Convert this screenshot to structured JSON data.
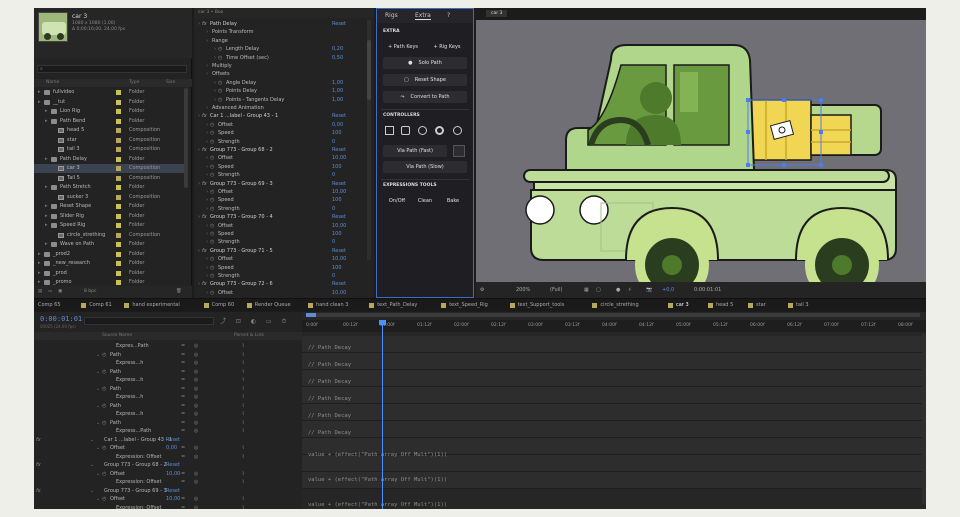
{
  "project": {
    "name": "car 3",
    "meta": [
      "1080 x 1080 (1.00)",
      "Δ 0;00;16;00, 24,00 fps"
    ],
    "columns": [
      "Name",
      "Type",
      "Size"
    ],
    "items": [
      {
        "label": "fullvideo",
        "type": "Folder",
        "color": "#c9c24f",
        "indent": 0,
        "kind": "folder"
      },
      {
        "label": "__tut",
        "type": "Folder",
        "color": "#c9c24f",
        "indent": 0,
        "kind": "folder"
      },
      {
        "label": "Lion Rig",
        "type": "Folder",
        "color": "#c9c24f",
        "indent": 1,
        "kind": "folder"
      },
      {
        "label": "Path Bend",
        "type": "Folder",
        "color": "#c9c24f",
        "indent": 1,
        "kind": "folder"
      },
      {
        "label": "head 5",
        "type": "Composition",
        "color": "#b7a85a",
        "indent": 2,
        "kind": "comp"
      },
      {
        "label": "star",
        "type": "Composition",
        "color": "#b7a85a",
        "indent": 2,
        "kind": "comp"
      },
      {
        "label": "tail 3",
        "type": "Composition",
        "color": "#b7a85a",
        "indent": 2,
        "kind": "comp"
      },
      {
        "label": "Path Delay",
        "type": "Folder",
        "color": "#c9c24f",
        "indent": 1,
        "kind": "folder"
      },
      {
        "label": "car 3",
        "type": "Composition",
        "color": "#b7a85a",
        "indent": 2,
        "kind": "comp",
        "selected": true
      },
      {
        "label": "Tail 5",
        "type": "Composition",
        "color": "#b7a85a",
        "indent": 2,
        "kind": "comp"
      },
      {
        "label": "Path Stretch",
        "type": "Folder",
        "color": "#c9c24f",
        "indent": 1,
        "kind": "folder"
      },
      {
        "label": "sucker 3",
        "type": "Composition",
        "color": "#b7a85a",
        "indent": 2,
        "kind": "comp"
      },
      {
        "label": "Reset Shape",
        "type": "Folder",
        "color": "#c9c24f",
        "indent": 1,
        "kind": "folder"
      },
      {
        "label": "Slider Rig",
        "type": "Folder",
        "color": "#c9c24f",
        "indent": 1,
        "kind": "folder"
      },
      {
        "label": "Speed Rig",
        "type": "Folder",
        "color": "#c9c24f",
        "indent": 1,
        "kind": "folder"
      },
      {
        "label": "circle_strething",
        "type": "Composition",
        "color": "#b7a85a",
        "indent": 2,
        "kind": "comp"
      },
      {
        "label": "Wave on Path",
        "type": "Folder",
        "color": "#c9c24f",
        "indent": 1,
        "kind": "folder"
      },
      {
        "label": "_prod2",
        "type": "Folder",
        "color": "#c9c24f",
        "indent": 0,
        "kind": "folder"
      },
      {
        "label": "_new_research",
        "type": "Folder",
        "color": "#c9c24f",
        "indent": 0,
        "kind": "folder"
      },
      {
        "label": "_prod",
        "type": "Folder",
        "color": "#c9c24f",
        "indent": 0,
        "kind": "folder"
      },
      {
        "label": "_promo",
        "type": "Folder",
        "color": "#c9c24f",
        "indent": 0,
        "kind": "folder"
      }
    ],
    "footer": "8 bpc"
  },
  "effects": {
    "tab": "car 3 • Box",
    "rows": [
      {
        "label": "Path Delay",
        "value": "Reset",
        "indent": 0,
        "group": true
      },
      {
        "label": "Points Transform",
        "indent": 1
      },
      {
        "label": "Range",
        "indent": 1
      },
      {
        "label": "Length Delay",
        "value": "0,20",
        "indent": 2
      },
      {
        "label": "Time Offset (sec)",
        "value": "0,50",
        "indent": 2
      },
      {
        "label": "Multiply",
        "indent": 1
      },
      {
        "label": "Offsets",
        "indent": 1
      },
      {
        "label": "Angle Delay",
        "value": "1,00",
        "indent": 2
      },
      {
        "label": "Points Delay",
        "value": "1,00",
        "indent": 2
      },
      {
        "label": "Points - Tangents Delay",
        "value": "1,00",
        "indent": 2
      },
      {
        "label": "Advanced Animation",
        "indent": 1
      },
      {
        "label": "Car 1 ...label - Group 43 - 1",
        "value": "Reset",
        "indent": 0,
        "group": true
      },
      {
        "label": "Offset",
        "value": "0,00",
        "indent": 1
      },
      {
        "label": "Speed",
        "value": "100",
        "indent": 1
      },
      {
        "label": "Strength",
        "value": "0",
        "indent": 1
      },
      {
        "label": "Group 773 - Group 68 - 2",
        "value": "Reset",
        "indent": 0,
        "group": true
      },
      {
        "label": "Offset",
        "value": "10,00",
        "indent": 1
      },
      {
        "label": "Speed",
        "value": "100",
        "indent": 1
      },
      {
        "label": "Strength",
        "value": "0",
        "indent": 1
      },
      {
        "label": "Group 773 - Group 69 - 3",
        "value": "Reset",
        "indent": 0,
        "group": true
      },
      {
        "label": "Offset",
        "value": "10,00",
        "indent": 1
      },
      {
        "label": "Speed",
        "value": "100",
        "indent": 1
      },
      {
        "label": "Strength",
        "value": "0",
        "indent": 1
      },
      {
        "label": "Group 773 - Group 70 - 4",
        "value": "Reset",
        "indent": 0,
        "group": true
      },
      {
        "label": "Offset",
        "value": "10,00",
        "indent": 1
      },
      {
        "label": "Speed",
        "value": "100",
        "indent": 1
      },
      {
        "label": "Strength",
        "value": "0",
        "indent": 1
      },
      {
        "label": "Group 773 - Group 71 - 5",
        "value": "Reset",
        "indent": 0,
        "group": true
      },
      {
        "label": "Offset",
        "value": "10,00",
        "indent": 1
      },
      {
        "label": "Speed",
        "value": "100",
        "indent": 1
      },
      {
        "label": "Strength",
        "value": "0",
        "indent": 1
      },
      {
        "label": "Group 773 - Group 72 - 6",
        "value": "Reset",
        "indent": 0,
        "group": true
      },
      {
        "label": "Offset",
        "value": "10,00",
        "indent": 1
      }
    ]
  },
  "rigs": {
    "tabs": [
      "Rigs",
      "Extra",
      "?"
    ],
    "extra_title": "EXTRA",
    "path_keys": "+ Path Keys",
    "rig_keys": "+ Rig Keys",
    "solo_path": "Solo Path",
    "reset_shape": "Reset Shape",
    "convert_to_path": "Convert to Path",
    "controllers_title": "CONTROLLERS",
    "via_path_fast": "Via Path (Fast)",
    "via_path_slow": "Via Path (Slow)",
    "expressions_title": "EXPRESSIONS TOOLS",
    "onoff": "On/Off",
    "clean": "Clean",
    "bake": "Bake"
  },
  "viewer": {
    "tab": "car 3",
    "zoom": "200%",
    "resolution": "(Full)",
    "exposure": "+0,0",
    "timecode": "0:00:01:01"
  },
  "tabs": [
    {
      "label": "Comp 65"
    },
    {
      "label": "Comp 61"
    },
    {
      "label": "hand experimental"
    },
    {
      "label": "Comp 60"
    },
    {
      "label": "Render Queue"
    },
    {
      "label": "hand clean 3"
    },
    {
      "label": "text_Path_Delay"
    },
    {
      "label": "text_Speed_Rig"
    },
    {
      "label": "text_Support_tools"
    },
    {
      "label": "circle_strething"
    },
    {
      "label": "car 3",
      "active": true
    },
    {
      "label": "head 5"
    },
    {
      "label": "star"
    },
    {
      "label": "tail 3"
    }
  ],
  "timeline": {
    "time": "0:00:01:01",
    "fps_label": "00025 (24.00 fps)",
    "columns": [
      "Source Name",
      "Parent & Link"
    ],
    "ruler": [
      "0:00f",
      "00:12f",
      "01:00f",
      "01:12f",
      "02:00f",
      "02:12f",
      "03:00f",
      "03:12f",
      "04:00f",
      "04:12f",
      "05:00f",
      "05:12f",
      "06:00f",
      "06:12f",
      "07:00f",
      "07:12f",
      "08:00f"
    ],
    "layers": [
      {
        "label": "Expres...Path",
        "indent": 3,
        "kind": "prop"
      },
      {
        "label": "Path",
        "indent": 2,
        "kind": "prop"
      },
      {
        "label": "Express...h",
        "indent": 3,
        "kind": "prop"
      },
      {
        "label": "Path",
        "indent": 2,
        "kind": "prop"
      },
      {
        "label": "Express...h",
        "indent": 3,
        "kind": "prop"
      },
      {
        "label": "Path",
        "indent": 2,
        "kind": "prop"
      },
      {
        "label": "Express...h",
        "indent": 3,
        "kind": "prop"
      },
      {
        "label": "Path",
        "indent": 2,
        "kind": "prop"
      },
      {
        "label": "Express...h",
        "indent": 3,
        "kind": "prop"
      },
      {
        "label": "Path",
        "indent": 2,
        "kind": "prop"
      },
      {
        "label": "Express...Path",
        "indent": 3,
        "kind": "prop"
      },
      {
        "label": "Car 1 ...label - Group 43 - 1",
        "value": "Reset",
        "indent": 1,
        "kind": "fx"
      },
      {
        "label": "Offset",
        "value": "0,00",
        "indent": 2,
        "kind": "prop"
      },
      {
        "label": "Expression: Offset",
        "indent": 3,
        "kind": "prop"
      },
      {
        "label": "Group 773 - Group 68 - 2",
        "value": "Reset",
        "indent": 1,
        "kind": "fx"
      },
      {
        "label": "Offset",
        "value": "10,00",
        "indent": 2,
        "kind": "prop"
      },
      {
        "label": "Expression: Offset",
        "indent": 3,
        "kind": "prop"
      },
      {
        "label": "Group 773 - Group 69 - 3",
        "value": "Reset",
        "indent": 1,
        "kind": "fx"
      },
      {
        "label": "Offset",
        "value": "10,00",
        "indent": 2,
        "kind": "prop"
      },
      {
        "label": "Expression: Offset",
        "indent": 3,
        "kind": "prop"
      }
    ],
    "expressions": [
      {
        "text": "// Path Decay",
        "row": 0
      },
      {
        "text": "// Path Decay",
        "row": 1
      },
      {
        "text": "// Path Decay",
        "row": 2
      },
      {
        "text": "// Path Decay",
        "row": 3
      },
      {
        "text": "// Path Decay",
        "row": 4
      },
      {
        "text": "// Path Decay",
        "row": 5
      },
      {
        "text": "value + (effect(\"Path Array Off Mult\")(1))",
        "row": 6
      },
      {
        "text": "value + (effect(\"Path Array Off Mult\")(1))",
        "row": 7
      },
      {
        "text": "value + (effect(\"Path Array Off Mult\")(1))",
        "row": 8
      }
    ]
  },
  "colors": {
    "truck_body": "#bcdc98",
    "truck_cab": "#b0d68c",
    "window": "#699a3f",
    "wheel_dark": "#2b3d1f",
    "wheel_ring": "#c7e28f",
    "crate": "#f1d654",
    "selection": "#4a7df0",
    "accent": "#5b8fd6"
  }
}
